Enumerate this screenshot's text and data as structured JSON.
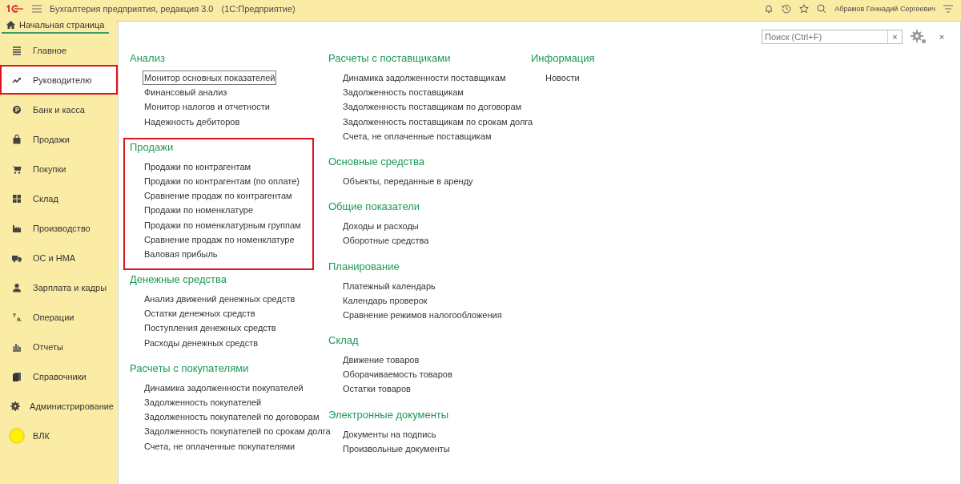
{
  "window": {
    "title": "Бухгалтерия предприятия, редакция 3.0",
    "subtitle": "(1С:Предприятие)",
    "user": "Абрамов Геннадий Сергеевич"
  },
  "tabs": [
    {
      "label": "Начальная страница",
      "selected": true
    }
  ],
  "sidebar": {
    "items": [
      {
        "label": "Главное",
        "selected": false,
        "highlighted": false
      },
      {
        "label": "Руководителю",
        "selected": true,
        "highlighted": true
      },
      {
        "label": "Банк и касса",
        "selected": false,
        "highlighted": false
      },
      {
        "label": "Продажи",
        "selected": false,
        "highlighted": false
      },
      {
        "label": "Покупки",
        "selected": false,
        "highlighted": false
      },
      {
        "label": "Склад",
        "selected": false,
        "highlighted": false
      },
      {
        "label": "Производство",
        "selected": false,
        "highlighted": false
      },
      {
        "label": "ОС и НМА",
        "selected": false,
        "highlighted": false
      },
      {
        "label": "Зарплата и кадры",
        "selected": false,
        "highlighted": false
      },
      {
        "label": "Операции",
        "selected": false,
        "highlighted": false
      },
      {
        "label": "Отчеты",
        "selected": false,
        "highlighted": false
      },
      {
        "label": "Справочники",
        "selected": false,
        "highlighted": false
      },
      {
        "label": "Администрирование",
        "selected": false,
        "highlighted": false
      },
      {
        "label": "ВЛК",
        "selected": false,
        "highlighted": false
      }
    ]
  },
  "search": {
    "placeholder": "Поиск (Ctrl+F)",
    "clear": "×"
  },
  "close": "×",
  "columns": [
    [
      {
        "title": "Анализ",
        "highlighted": false,
        "items": [
          {
            "label": "Монитор основных показателей",
            "focused": true
          },
          {
            "label": "Финансовый анализ",
            "focused": false
          },
          {
            "label": "Монитор налогов и отчетности",
            "focused": false
          },
          {
            "label": "Надежность дебиторов",
            "focused": false
          }
        ]
      },
      {
        "title": "Продажи",
        "highlighted": true,
        "items": [
          {
            "label": "Продажи по контрагентам",
            "focused": false
          },
          {
            "label": "Продажи по контрагентам (по оплате)",
            "focused": false
          },
          {
            "label": "Сравнение продаж по контрагентам",
            "focused": false
          },
          {
            "label": "Продажи по номенклатуре",
            "focused": false
          },
          {
            "label": "Продажи по номенклатурным группам",
            "focused": false
          },
          {
            "label": "Сравнение продаж по номенклатуре",
            "focused": false
          },
          {
            "label": "Валовая прибыль",
            "focused": false
          }
        ]
      },
      {
        "title": "Денежные средства",
        "highlighted": false,
        "items": [
          {
            "label": "Анализ движений денежных средств",
            "focused": false
          },
          {
            "label": "Остатки денежных средств",
            "focused": false
          },
          {
            "label": "Поступления денежных средств",
            "focused": false
          },
          {
            "label": "Расходы денежных средств",
            "focused": false
          }
        ]
      },
      {
        "title": "Расчеты с покупателями",
        "highlighted": false,
        "items": [
          {
            "label": "Динамика задолженности покупателей",
            "focused": false
          },
          {
            "label": "Задолженность покупателей",
            "focused": false
          },
          {
            "label": "Задолженность покупателей по договорам",
            "focused": false
          },
          {
            "label": "Задолженность покупателей по срокам долга",
            "focused": false
          },
          {
            "label": "Счета, не оплаченные покупателями",
            "focused": false
          }
        ]
      }
    ],
    [
      {
        "title": "Расчеты с поставщиками",
        "highlighted": false,
        "items": [
          {
            "label": "Динамика задолженности поставщикам",
            "focused": false
          },
          {
            "label": "Задолженность поставщикам",
            "focused": false
          },
          {
            "label": "Задолженность поставщикам по договорам",
            "focused": false
          },
          {
            "label": "Задолженность поставщикам по срокам долга",
            "focused": false
          },
          {
            "label": "Счета, не оплаченные поставщикам",
            "focused": false
          }
        ]
      },
      {
        "title": "Основные средства",
        "highlighted": false,
        "items": [
          {
            "label": "Объекты, переданные в аренду",
            "focused": false
          }
        ]
      },
      {
        "title": "Общие показатели",
        "highlighted": false,
        "items": [
          {
            "label": "Доходы и расходы",
            "focused": false
          },
          {
            "label": "Оборотные средства",
            "focused": false
          }
        ]
      },
      {
        "title": "Планирование",
        "highlighted": false,
        "items": [
          {
            "label": "Платежный календарь",
            "focused": false
          },
          {
            "label": "Календарь проверок",
            "focused": false
          },
          {
            "label": "Сравнение режимов налогообложения",
            "focused": false
          }
        ]
      },
      {
        "title": "Склад",
        "highlighted": false,
        "items": [
          {
            "label": "Движение товаров",
            "focused": false
          },
          {
            "label": "Оборачиваемость товаров",
            "focused": false
          },
          {
            "label": "Остатки товаров",
            "focused": false
          }
        ]
      },
      {
        "title": "Электронные документы",
        "highlighted": false,
        "items": [
          {
            "label": "Документы на подпись",
            "focused": false
          },
          {
            "label": "Произвольные документы",
            "focused": false
          }
        ]
      }
    ],
    [
      {
        "title": "Информация",
        "highlighted": false,
        "items": [
          {
            "label": "Новости",
            "focused": false
          }
        ]
      }
    ]
  ]
}
